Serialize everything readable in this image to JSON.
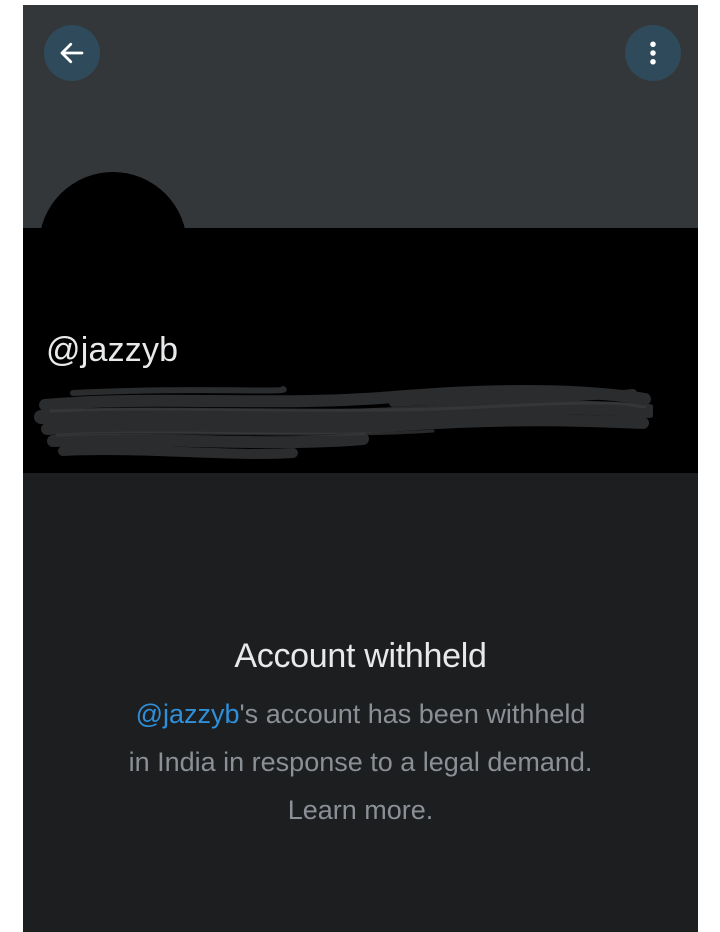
{
  "profile": {
    "handle": "@jazzyb"
  },
  "withheld": {
    "title": "Account withheld",
    "mention": "@jazzyb",
    "message_line1": "'s account has been withheld",
    "message_line2": "in India in response to a legal demand.",
    "learn_more": "Learn more."
  },
  "icons": {
    "back": "arrow-left-icon",
    "more": "more-vertical-icon"
  },
  "colors": {
    "banner": "#34373a",
    "background": "#1c1e20",
    "accent": "#2f8fd8",
    "button_bg": "#2f4a5a"
  }
}
